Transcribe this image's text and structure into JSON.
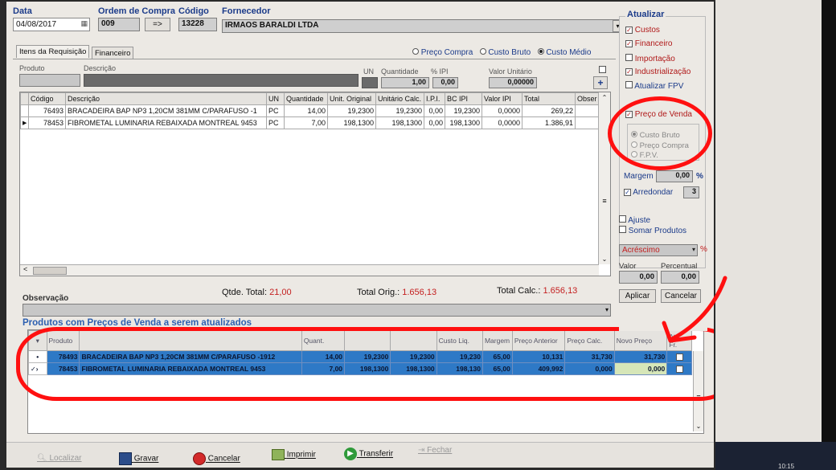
{
  "header": {
    "data_label": "Data",
    "data_value": "04/08/2017",
    "ordem_label": "Ordem de Compra",
    "ordem_value": "009",
    "goto_label": "=>",
    "codigo_label": "Código",
    "codigo_value": "13228",
    "fornecedor_label": "Fornecedor",
    "fornecedor_value": "IRMAOS BARALDI LTDA"
  },
  "tabs": [
    "Itens da Requisição",
    "Financeiro"
  ],
  "cost_mode": {
    "options": [
      "Preço Compra",
      "Custo Bruto",
      "Custo Médio"
    ],
    "selected": "Custo Médio"
  },
  "entry": {
    "produto_label": "Produto",
    "descricao_label": "Descrição",
    "un_label": "UN",
    "quantidade_label": "Quantidade",
    "quantidade_value": "1,00",
    "ipi_label": "% IPI",
    "ipi_value": "0,00",
    "valor_label": "Valor Unitário",
    "valor_value": "0,00000",
    "add_label": "+"
  },
  "items": {
    "columns": [
      "Código",
      "Descrição",
      "UN",
      "Quantidade",
      "Unit. Original",
      "Unitário Calc.",
      "I.P.I.",
      "BC IPI",
      "Valor IPI",
      "Total",
      "Obser"
    ],
    "rows": [
      [
        "76493",
        "BRACADEIRA BAP NP3 1,20CM 381MM C/PARAFUSO -1",
        "PC",
        "14,00",
        "19,2300",
        "19,2300",
        "0,00",
        "19,2300",
        "0,0000",
        "269,22",
        ""
      ],
      [
        "78453",
        "FIBROMETAL LUMINARIA REBAIXADA MONTREAL 9453",
        "PC",
        "7,00",
        "198,1300",
        "198,1300",
        "0,00",
        "198,1300",
        "0,0000",
        "1.386,91",
        ""
      ]
    ]
  },
  "totals": {
    "qtde_label": "Qtde. Total:",
    "qtde_value": "21,00",
    "orig_label": "Total Orig.:",
    "orig_value": "1.656,13",
    "calc_label": "Total Calc.:",
    "calc_value": "1.656,13"
  },
  "observacao_label": "Observação",
  "sale_prices": {
    "title": "Produtos com Preços de Venda a serem atualizados",
    "columns": [
      "Produto",
      "",
      "Quant.",
      "",
      "",
      "Custo Liq.",
      "Margem",
      "Preço Anterior",
      "Preço Calc.",
      "Novo Preço",
      "Atu. Fr."
    ],
    "rows": [
      [
        "78493",
        "BRACADEIRA BAP NP3 1,20CM 381MM C/PARAFUSO -1912",
        "14,00",
        "19,2300",
        "19,2300",
        "19,230",
        "65,00",
        "10,131",
        "31,730",
        "31,730",
        ""
      ],
      [
        "78453",
        "FIBROMETAL LUMINARIA REBAIXADA MONTREAL 9453",
        "7,00",
        "198,1300",
        "198,1300",
        "198,130",
        "65,00",
        "409,992",
        "0,000",
        "0,000",
        ""
      ]
    ]
  },
  "bottom_buttons": [
    "Localizar",
    "Gravar",
    "Cancelar",
    "Imprimir",
    "Transferir",
    "Fechar"
  ],
  "right_panel": {
    "atualizar_label": "Atualizar",
    "checks": [
      {
        "label": "Custos",
        "checked": true
      },
      {
        "label": "Financeiro",
        "checked": true
      },
      {
        "label": "Importação",
        "checked": false
      },
      {
        "label": "Industrialização",
        "checked": true
      },
      {
        "label": "Atualizar FPV",
        "checked": false
      }
    ],
    "preco_venda_label": "Preço de Venda",
    "preco_options": [
      "Custo Bruto",
      "Preço Compra",
      "F.P.V."
    ],
    "margem_label": "Margem",
    "margem_value": "0,00",
    "pct": "%",
    "arredondar_label": "Arredondar",
    "arredondar_value": "3",
    "ajuste_label": "Ajuste",
    "somar_label": "Somar Produtos",
    "acrescimo_value": "Acréscimo",
    "valor_label": "Valor",
    "valor_value": "0,00",
    "percentual_label": "Percentual",
    "percentual_value": "0,00",
    "aplicar_label": "Aplicar",
    "cancelar_label": "Cancelar"
  },
  "clock": "10:15"
}
